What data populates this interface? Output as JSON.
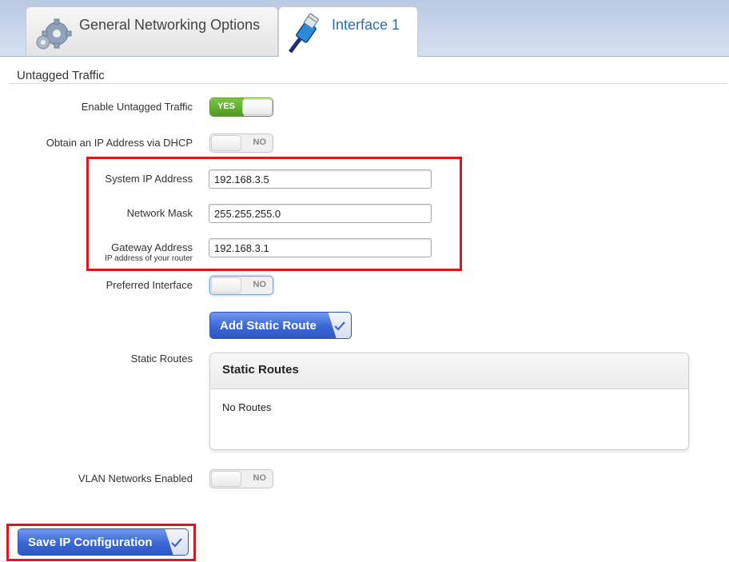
{
  "tabs": [
    {
      "label": "General Networking Options",
      "icon": "gear-icon",
      "active": false
    },
    {
      "label": "Interface 1",
      "icon": "ethernet-cable-icon",
      "active": true
    }
  ],
  "section": {
    "title": "Untagged Traffic"
  },
  "fields": {
    "enable_untagged": {
      "label": "Enable Untagged Traffic",
      "value": "YES"
    },
    "dhcp": {
      "label": "Obtain an IP Address via DHCP",
      "value": "NO"
    },
    "system_ip": {
      "label": "System IP Address",
      "value": "192.168.3.5"
    },
    "network_mask": {
      "label": "Network Mask",
      "value": "255.255.255.0"
    },
    "gateway": {
      "label": "Gateway Address",
      "sublabel": "IP address of your router",
      "value": "192.168.3.1"
    },
    "preferred_interface": {
      "label": "Preferred Interface",
      "value": "NO"
    },
    "static_routes": {
      "label": "Static Routes"
    },
    "vlan": {
      "label": "VLAN Networks Enabled",
      "value": "NO"
    }
  },
  "buttons": {
    "add_static_route": "Add Static Route",
    "save": "Save IP Configuration"
  },
  "static_routes_panel": {
    "title": "Static Routes",
    "empty_text": "No Routes"
  },
  "colors": {
    "highlight": "#e0141b",
    "button_blue": "#3a67d6",
    "toggle_on": "#5fa82a",
    "tab_active_text": "#2b6db8"
  }
}
